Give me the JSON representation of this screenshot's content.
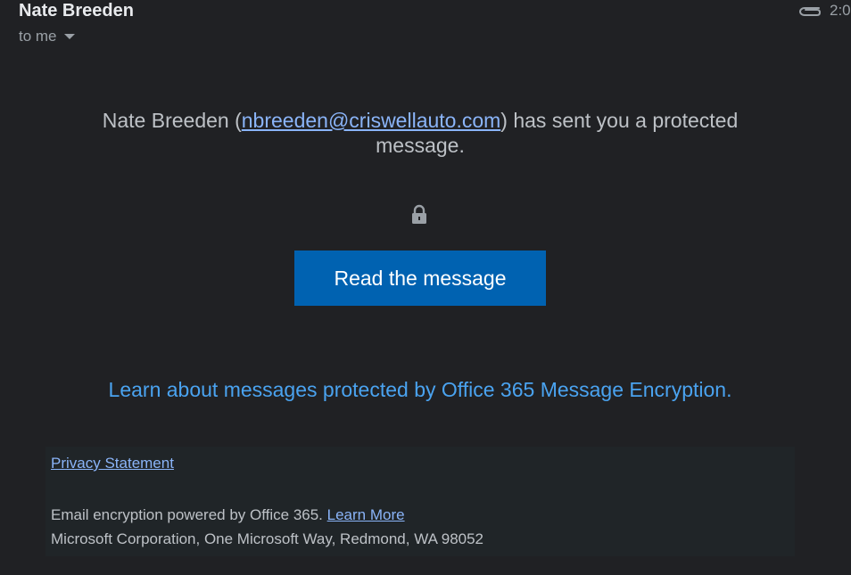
{
  "header": {
    "sender_name": "Nate Breeden",
    "recipient_label": "to me",
    "time_partial": "2:0",
    "attachment_icon": "paperclip-icon"
  },
  "message": {
    "intro_prefix": "Nate Breeden (",
    "sender_email": "nbreeden@criswellauto.com",
    "intro_suffix": ") has sent you a protected message.",
    "lock_icon": "lock-icon",
    "read_button_label": "Read the message",
    "learn_link_text": "Learn about messages protected by Office 365 Message Encryption."
  },
  "footer": {
    "privacy_label": "Privacy Statement",
    "powered_text": "Email encryption powered by Office 365.",
    "learn_more_label": "Learn More",
    "address": "Microsoft Corporation, One Microsoft Way, Redmond, WA 98052"
  },
  "colors": {
    "background": "#202124",
    "button": "#0062b1",
    "link": "#4aa3f0",
    "footer_bg": "#202528"
  }
}
